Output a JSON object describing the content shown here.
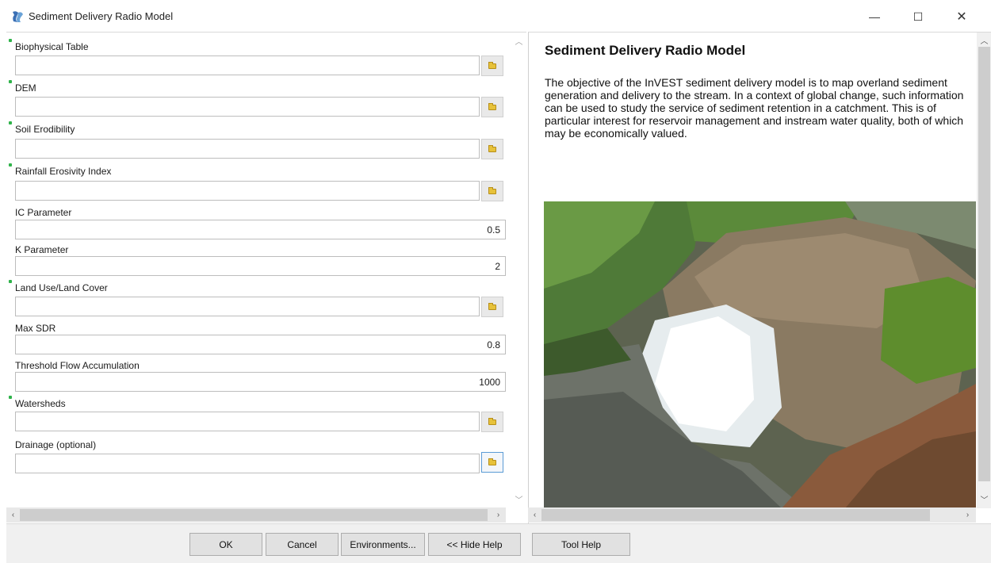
{
  "window": {
    "title": "Sediment Delivery Radio Model",
    "minimize_glyph": "—",
    "maximize_glyph": "☐",
    "close_glyph": "✕"
  },
  "form": {
    "fields": [
      {
        "label": "Biophysical Table",
        "required": true,
        "type": "file",
        "value": ""
      },
      {
        "label": "DEM",
        "required": true,
        "type": "file",
        "value": ""
      },
      {
        "label": "Soil Erodibility",
        "required": true,
        "type": "file",
        "value": ""
      },
      {
        "label": "Rainfall Erosivity Index",
        "required": true,
        "type": "file",
        "value": ""
      },
      {
        "label": "IC Parameter",
        "required": false,
        "type": "number",
        "value": "0.5"
      },
      {
        "label": "K Parameter",
        "required": false,
        "type": "number",
        "value": "2"
      },
      {
        "label": "Land Use/Land Cover",
        "required": true,
        "type": "file",
        "value": ""
      },
      {
        "label": "Max SDR",
        "required": false,
        "type": "number",
        "value": "0.8"
      },
      {
        "label": "Threshold Flow Accumulation",
        "required": false,
        "type": "number",
        "value": "1000"
      },
      {
        "label": "Watersheds",
        "required": true,
        "type": "file",
        "value": ""
      },
      {
        "label": "Drainage (optional)",
        "required": false,
        "type": "file",
        "value": ""
      }
    ]
  },
  "help": {
    "title": "Sediment Delivery Radio Model",
    "body": "The objective of the InVEST sediment delivery model is to map overland sediment generation and delivery to the stream. In a context of global change, such information can be used to study the service of sediment retention in a catchment. This is of particular interest for reservoir management and instream water quality, both of which may be economically valued."
  },
  "buttons": {
    "ok": "OK",
    "cancel": "Cancel",
    "environments": "Environments...",
    "hide_help": "<< Hide Help",
    "tool_help": "Tool Help"
  },
  "icons": {
    "app": "arcgis-tool-icon",
    "browse": "folder-open-icon"
  },
  "colors": {
    "required_marker": "#2fb34a",
    "focus_border": "#5b9bd5"
  }
}
